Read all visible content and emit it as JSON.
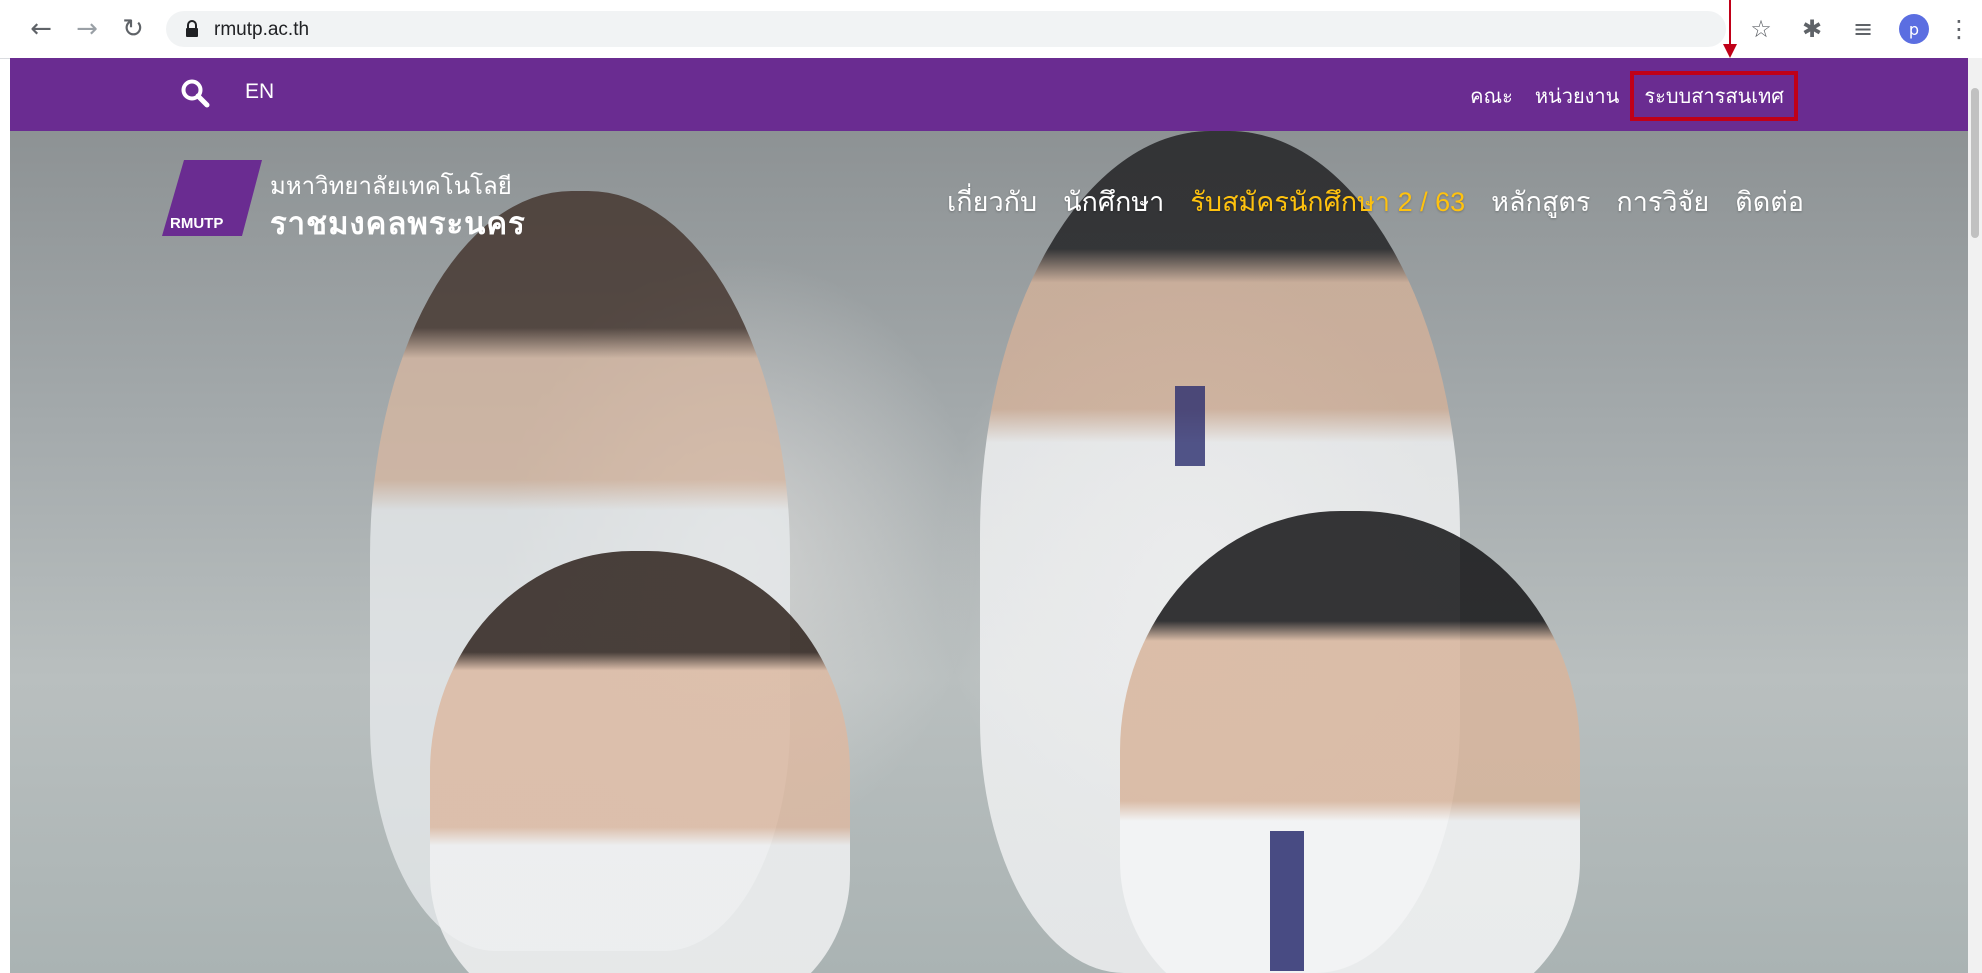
{
  "browser": {
    "url": "rmutp.ac.th",
    "back_icon": "arrow-left-icon",
    "forward_icon": "arrow-right-icon",
    "reload_icon": "reload-icon",
    "profile_initial": "p"
  },
  "site_header": {
    "lang": "EN",
    "top_links": [
      "คณะ",
      "หน่วยงาน",
      "ระบบสารสนเทศ"
    ],
    "highlight_color": "#c00018",
    "bar_color": "#6a2c91"
  },
  "logo": {
    "mark": "RMUTP",
    "line1": "มหาวิทยาลัยเทคโนโลยี",
    "line2": "ราชมงคลพระนคร"
  },
  "main_nav": {
    "items": [
      "เกี่ยวกับ",
      "นักศึกษา",
      "รับสมัครนักศึกษา 2 / 63",
      "หลักสูตร",
      "การวิจัย",
      "ติดต่อ"
    ],
    "accent_color": "#ffc20e"
  }
}
